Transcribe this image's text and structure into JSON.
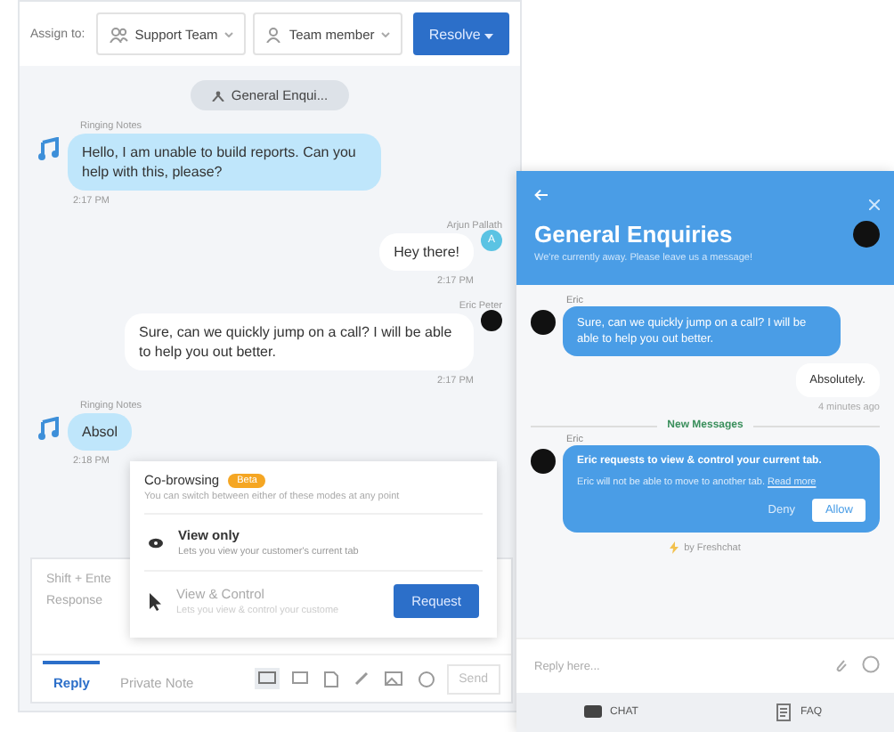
{
  "toolbar": {
    "assign_label": "Assign to:",
    "dropdowns": [
      {
        "kind": "team",
        "label": "Support Team"
      },
      {
        "kind": "member",
        "label": "Team member"
      }
    ],
    "resolve_button": "Resolve"
  },
  "conversation": {
    "topic": "General Enqui...",
    "messages": [
      {
        "kind": "incoming",
        "sender": "Ringing Notes",
        "text": "Hello, I am unable to build reports. Can you help with this, please?",
        "time": "2:17 PM"
      },
      {
        "kind": "outgoing",
        "sender": "Arjun Pallath",
        "text": "Hey there!",
        "time": "2:17 PM",
        "avatar": "A"
      },
      {
        "kind": "outgoing",
        "sender": "Eric Peter",
        "text": "Sure, can we quickly jump on a call? I will be able to help you out better.",
        "time": "2:17 PM"
      },
      {
        "kind": "incoming",
        "sender": "Ringing Notes",
        "text": "Absol",
        "time": "2:18 PM"
      }
    ]
  },
  "cobrowse_popup": {
    "title": "Co-browsing",
    "badge": "Beta",
    "description": "You can switch between either of these modes at any point",
    "options": [
      {
        "kind": "view",
        "title": "View only",
        "description": "Lets you view your customer's current tab",
        "disabled": false
      },
      {
        "kind": "control",
        "title": "View & Control",
        "description": "Lets you view & control your custome",
        "disabled": true,
        "button": "Request"
      }
    ]
  },
  "composer": {
    "placeholder": "Shift + Ente\nResponse",
    "tabs": [
      {
        "label": "Reply",
        "selected": true
      },
      {
        "label": "Private Note",
        "selected": false
      }
    ],
    "send_button": "Send"
  },
  "widget": {
    "title": "General Enquiries",
    "subtitle": "We're currently away. Please leave us a message!",
    "messages": [
      {
        "kind": "incoming",
        "sender": "Eric",
        "text": "Sure, can we quickly jump on a call? I will be able to help you out better."
      },
      {
        "kind": "outgoing",
        "text": "Absolutely.",
        "time": "4 minutes ago"
      }
    ],
    "divider": "New Messages",
    "request": {
      "sender": "Eric",
      "title": "Eric requests to view & control your current tab.",
      "text": "Eric will not be able to move to another tab.",
      "link": "Read more",
      "deny": "Deny",
      "allow": "Allow"
    },
    "powered_by": "by Freshchat",
    "reply_placeholder": "Reply here...",
    "tabs": [
      {
        "kind": "chat",
        "label": "CHAT"
      },
      {
        "kind": "faq",
        "label": "FAQ"
      }
    ]
  }
}
